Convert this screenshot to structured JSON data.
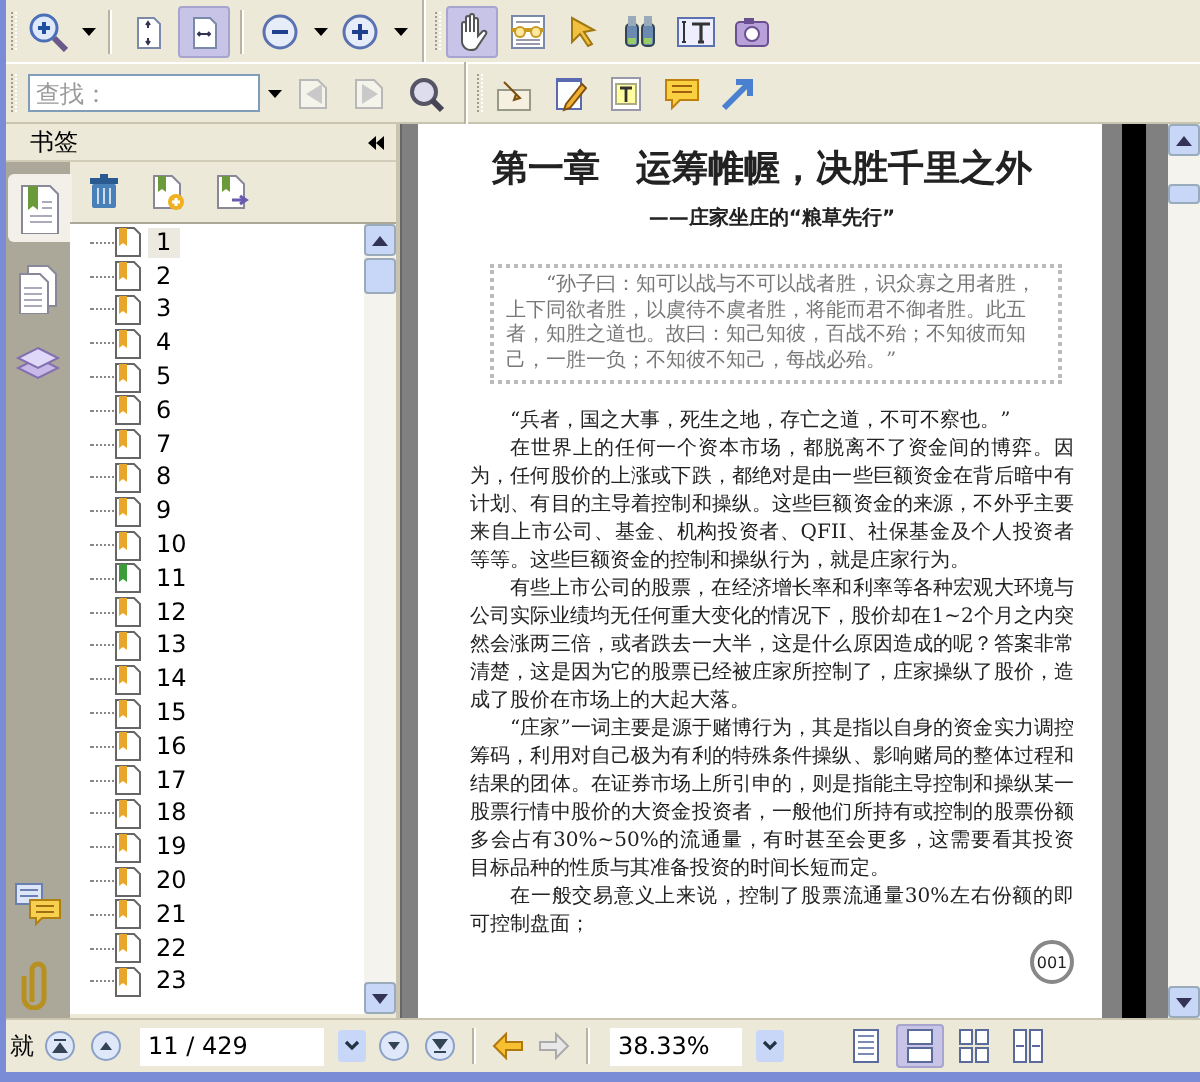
{
  "toolbar": {
    "tools": [
      {
        "kind": "zoom",
        "selected": false
      },
      {
        "kind": "fit-page",
        "selected": false
      },
      {
        "kind": "fit-width",
        "selected": true
      },
      {
        "kind": "zoom-out",
        "selected": false
      },
      {
        "kind": "zoom-in",
        "selected": false
      },
      {
        "kind": "hand",
        "selected": true
      },
      {
        "kind": "reading",
        "selected": false
      },
      {
        "kind": "select",
        "selected": false
      },
      {
        "kind": "find",
        "selected": false
      },
      {
        "kind": "text-select",
        "selected": false
      },
      {
        "kind": "snapshot",
        "selected": false
      }
    ],
    "search": {
      "placeholder": "查找："
    },
    "search_buttons": [
      {
        "kind": "previous",
        "disabled": true
      },
      {
        "kind": "next",
        "disabled": true
      },
      {
        "kind": "advanced",
        "disabled": false
      }
    ],
    "annotation_tools": [
      {
        "kind": "stamp",
        "selected": false
      },
      {
        "kind": "note",
        "selected": false
      },
      {
        "kind": "textbox",
        "selected": false
      },
      {
        "kind": "comment",
        "selected": false
      },
      {
        "kind": "arrow",
        "selected": false
      }
    ]
  },
  "sidebar": {
    "title": "书签",
    "tabs": [
      {
        "kind": "bookmarks",
        "selected": true
      },
      {
        "kind": "pages",
        "selected": false
      },
      {
        "kind": "layers",
        "selected": false
      },
      {
        "kind": "comments",
        "selected": false
      },
      {
        "kind": "attachments",
        "selected": false
      }
    ],
    "tools": [
      {
        "kind": "delete"
      },
      {
        "kind": "new"
      },
      {
        "kind": "move"
      }
    ],
    "bookmarks": [
      {
        "label": "1",
        "selected": true,
        "color": "#e8a62a"
      },
      {
        "label": "2",
        "selected": false,
        "color": "#e8a62a"
      },
      {
        "label": "3",
        "selected": false,
        "color": "#e8a62a"
      },
      {
        "label": "4",
        "selected": false,
        "color": "#e8a62a"
      },
      {
        "label": "5",
        "selected": false,
        "color": "#e8a62a"
      },
      {
        "label": "6",
        "selected": false,
        "color": "#e8a62a"
      },
      {
        "label": "7",
        "selected": false,
        "color": "#e8a62a"
      },
      {
        "label": "8",
        "selected": false,
        "color": "#e8a62a"
      },
      {
        "label": "9",
        "selected": false,
        "color": "#e8a62a"
      },
      {
        "label": "10",
        "selected": false,
        "color": "#e8a62a"
      },
      {
        "label": "11",
        "selected": false,
        "color": "#3c9c3c"
      },
      {
        "label": "12",
        "selected": false,
        "color": "#e8a62a"
      },
      {
        "label": "13",
        "selected": false,
        "color": "#e8a62a"
      },
      {
        "label": "14",
        "selected": false,
        "color": "#e8a62a"
      },
      {
        "label": "15",
        "selected": false,
        "color": "#e8a62a"
      },
      {
        "label": "16",
        "selected": false,
        "color": "#e8a62a"
      },
      {
        "label": "17",
        "selected": false,
        "color": "#e8a62a"
      },
      {
        "label": "18",
        "selected": false,
        "color": "#e8a62a"
      },
      {
        "label": "19",
        "selected": false,
        "color": "#e8a62a"
      },
      {
        "label": "20",
        "selected": false,
        "color": "#e8a62a"
      },
      {
        "label": "21",
        "selected": false,
        "color": "#e8a62a"
      },
      {
        "label": "22",
        "selected": false,
        "color": "#e8a62a"
      },
      {
        "label": "23",
        "selected": false,
        "color": "#e8a62a"
      }
    ]
  },
  "document": {
    "title": "第一章　运筹帷幄，决胜千里之外",
    "subtitle": "——庄家坐庄的“粮草先行”",
    "quote": "“孙子曰：知可以战与不可以战者胜，识众寡之用者胜，上下同欲者胜，以虞待不虞者胜，将能而君不御者胜。此五者，知胜之道也。故曰：知己知彼，百战不殆；不知彼而知己，一胜一负；不知彼不知己，每战必殆。”",
    "paragraphs": [
      "“兵者，国之大事，死生之地，存亡之道，不可不察也。”",
      "在世界上的任何一个资本市场，都脱离不了资金间的博弈。因为，任何股价的上涨或下跌，都绝对是由一些巨额资金在背后暗中有计划、有目的主导着控制和操纵。这些巨额资金的来源，不外乎主要来自上市公司、基金、机构投资者、QFII、社保基金及个人投资者等等。这些巨额资金的控制和操纵行为，就是庄家行为。",
      "有些上市公司的股票，在经济增长率和利率等各种宏观大环境与公司实际业绩均无任何重大变化的情况下，股价却在1~2个月之内突然会涨两三倍，或者跌去一大半，这是什么原因造成的呢？答案非常清楚，这是因为它的股票已经被庄家所控制了，庄家操纵了股价，造成了股价在市场上的大起大落。",
      "“庄家”一词主要是源于赌博行为，其是指以自身的资金实力调控筹码，利用对自己极为有利的特殊条件操纵、影响赌局的整体过程和结果的团体。在证券市场上所引申的，则是指能主导控制和操纵某一股票行情中股价的大资金投资者，一般他们所持有或控制的股票份额多会占有30%~50%的流通量，有时甚至会更多，这需要看其投资目标品种的性质与其准备投资的时间长短而定。",
      "在一般交易意义上来说，控制了股票流通量30%左右份额的即可控制盘面；"
    ],
    "page_number": "001"
  },
  "status_bar": {
    "label": "就",
    "page": "11 / 429",
    "zoom": "38.33%",
    "history": [
      {
        "kind": "back",
        "disabled": false
      },
      {
        "kind": "forward",
        "disabled": true
      }
    ],
    "view_modes": [
      {
        "kind": "single",
        "selected": false
      },
      {
        "kind": "continuous",
        "selected": true
      },
      {
        "kind": "facing",
        "selected": false
      },
      {
        "kind": "continuous-facing",
        "selected": false
      }
    ]
  }
}
